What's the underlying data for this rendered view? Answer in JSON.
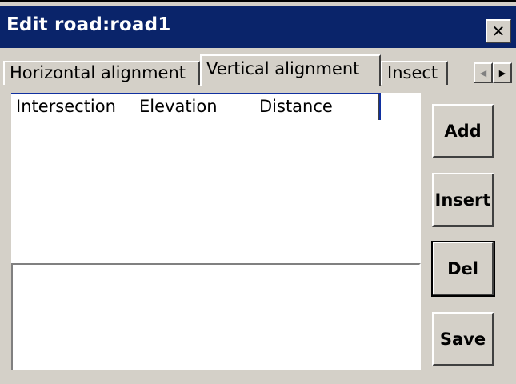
{
  "window": {
    "title": "Edit road:road1",
    "close_glyph": "✕"
  },
  "tabs": [
    {
      "label": "Horizontal alignment",
      "active": false
    },
    {
      "label": "Vertical alignment",
      "active": true
    },
    {
      "label": "Insect",
      "active": false
    }
  ],
  "tab_scroll": {
    "left_glyph": "◀",
    "right_glyph": "▶"
  },
  "list": {
    "columns": [
      "Intersection",
      "Elevation",
      "Distance"
    ],
    "rows": []
  },
  "buttons": {
    "add": "Add",
    "insert": "Insert",
    "del": "Del",
    "save": "Save"
  },
  "colors": {
    "titlebar": "#0a246a",
    "face": "#d4d0c8",
    "header_accent": "#1030a0"
  },
  "icons": [
    "close-icon",
    "scroll-left-icon",
    "scroll-right-icon"
  ]
}
